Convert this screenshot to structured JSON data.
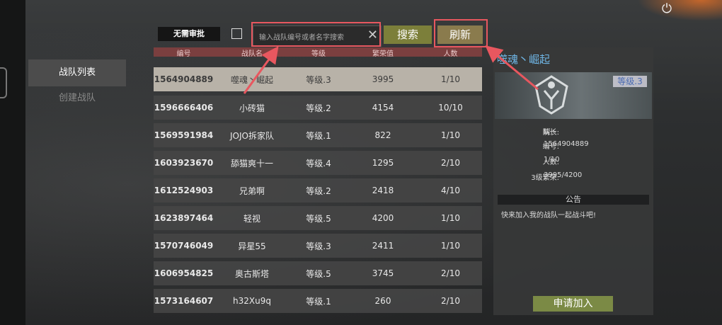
{
  "tabs": {
    "list": "战队列表",
    "create": "创建战队"
  },
  "toolbar": {
    "approve_label": "无需审批",
    "search_placeholder": "输入战队编号或者名字搜索",
    "search_label": "搜索",
    "refresh_label": "刷新"
  },
  "table": {
    "headers": [
      "编号",
      "战队名",
      "等级",
      "繁荣值",
      "人数"
    ],
    "rows": [
      [
        "1564904889",
        "噬魂丶崛起",
        "等级.3",
        "3995",
        "1/10"
      ],
      [
        "1596666406",
        "小砖猫",
        "等级.2",
        "4154",
        "10/10"
      ],
      [
        "1569591984",
        "JOJO拆家队",
        "等级.1",
        "822",
        "1/10"
      ],
      [
        "1603923670",
        "舔猫爽十一",
        "等级.4",
        "1295",
        "2/10"
      ],
      [
        "1612524903",
        "兄弟啊",
        "等级.2",
        "2418",
        "4/10"
      ],
      [
        "1623897464",
        "轻视",
        "等级.5",
        "4200",
        "1/10"
      ],
      [
        "1570746049",
        "异星55",
        "等级.3",
        "2411",
        "1/10"
      ],
      [
        "1606954825",
        "奥古斯塔",
        "等级.5",
        "3745",
        "2/10"
      ],
      [
        "1573164607",
        "h32Xu9q",
        "等级.1",
        "260",
        "2/10"
      ]
    ]
  },
  "detail": {
    "team_name": "噬魂丶崛起",
    "level_badge": "等级.3",
    "captain_label": "队长:",
    "captain_value": "睬丶",
    "id_label": "编号:",
    "id_value": "1564904889",
    "members_label": "人数:",
    "members_value": "1/10",
    "prosperity_label": "3级繁荣:",
    "prosperity_value": "3995/4200",
    "notice_head": "公告",
    "notice_text": "快来加入我的战队一起战斗吧!",
    "join_label": "申请加入"
  },
  "colors": {
    "highlight": "#e8575f",
    "team_name": "#6fb6e6",
    "header_row": "#7b3f3f"
  },
  "icons": {
    "power": "power-icon",
    "clear": "close-icon"
  }
}
